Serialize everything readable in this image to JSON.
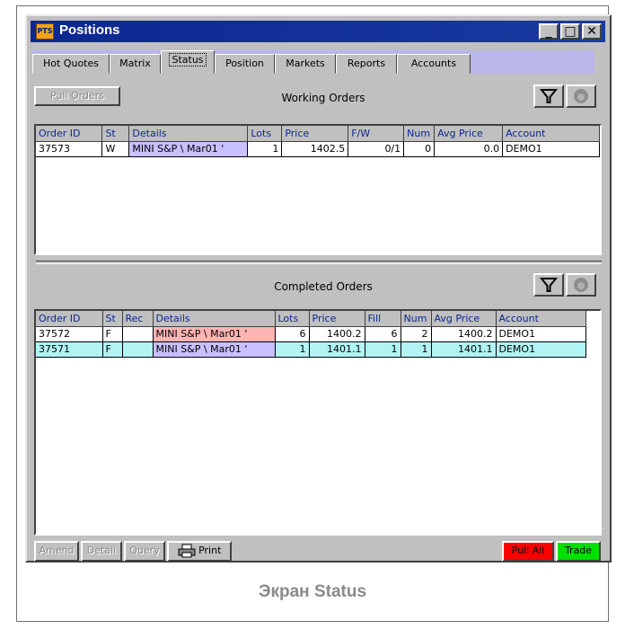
{
  "window": {
    "title": "Positions",
    "app_icon_text": "PTS"
  },
  "titlebar": {
    "minimize": "_",
    "maximize": "□",
    "close": "✕"
  },
  "tabs": [
    "Hot Quotes",
    "Matrix",
    "Status",
    "Position",
    "Markets",
    "Reports",
    "Accounts"
  ],
  "active_tab": "Status",
  "working": {
    "pull_orders_label": "Pull Orders",
    "title": "Working Orders",
    "columns": [
      "Order ID",
      "St",
      "Details",
      "Lots",
      "Price",
      "F/W",
      "Num",
      "Avg Price",
      "Account"
    ],
    "rows": [
      [
        "37573",
        "W",
        "MINI S&P \\ Mar01 '",
        "1",
        "1402.5",
        "0/1",
        "0",
        "0.0",
        "DEMO1"
      ]
    ]
  },
  "completed": {
    "title": "Completed Orders",
    "columns": [
      "Order ID",
      "St",
      "Rec",
      "Details",
      "Lots",
      "Price",
      "Fill",
      "Num",
      "Avg Price",
      "Account"
    ],
    "rows": [
      [
        "37572",
        "F",
        "",
        "MINI S&P \\ Mar01 '",
        "6",
        "1400.2",
        "6",
        "2",
        "1400.2",
        "DEMO1"
      ],
      [
        "37571",
        "F",
        "",
        "MINI S&P \\ Mar01 '",
        "1",
        "1401.1",
        "1",
        "1",
        "1401.1",
        "DEMO1"
      ]
    ]
  },
  "bottom": {
    "amend": "Amend",
    "detail": "Detail",
    "query": "Query",
    "print": "Print",
    "pull_all": "Pull All",
    "trade": "Trade"
  },
  "caption": "Экран Status",
  "icons": [
    "filter-icon",
    "shield-icon",
    "printer-icon"
  ],
  "colors": {
    "title_bar": "#0b2790",
    "tab_strip": "#b9b6e8",
    "details_buy": "#c8c0ff",
    "details_sell": "#ffb4b4",
    "row_selected": "#b0f4f4",
    "pull_all": "#ff0000",
    "trade": "#00e000"
  }
}
